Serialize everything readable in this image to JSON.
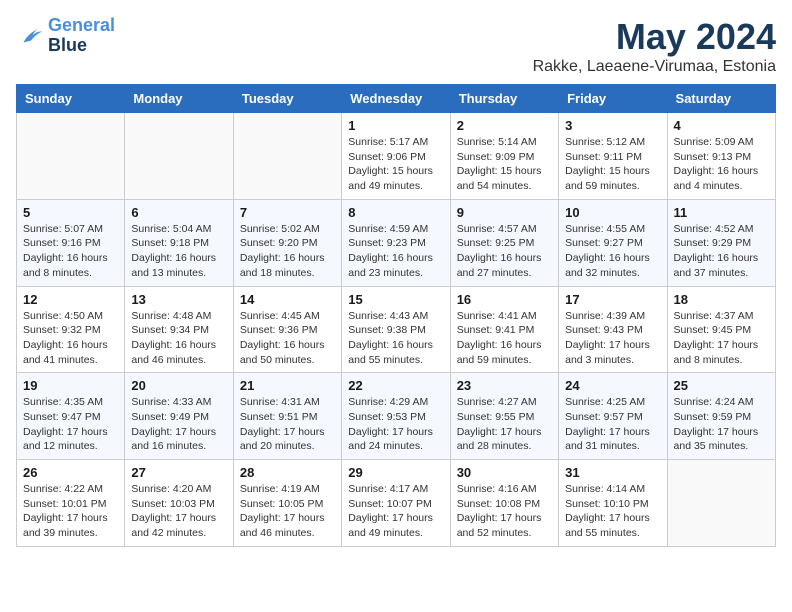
{
  "logo": {
    "line1": "General",
    "line2": "Blue"
  },
  "title": "May 2024",
  "subtitle": "Rakke, Laeaene-Virumaa, Estonia",
  "weekdays": [
    "Sunday",
    "Monday",
    "Tuesday",
    "Wednesday",
    "Thursday",
    "Friday",
    "Saturday"
  ],
  "rows": [
    [
      {
        "day": "",
        "info": ""
      },
      {
        "day": "",
        "info": ""
      },
      {
        "day": "",
        "info": ""
      },
      {
        "day": "1",
        "info": "Sunrise: 5:17 AM\nSunset: 9:06 PM\nDaylight: 15 hours and 49 minutes."
      },
      {
        "day": "2",
        "info": "Sunrise: 5:14 AM\nSunset: 9:09 PM\nDaylight: 15 hours and 54 minutes."
      },
      {
        "day": "3",
        "info": "Sunrise: 5:12 AM\nSunset: 9:11 PM\nDaylight: 15 hours and 59 minutes."
      },
      {
        "day": "4",
        "info": "Sunrise: 5:09 AM\nSunset: 9:13 PM\nDaylight: 16 hours and 4 minutes."
      }
    ],
    [
      {
        "day": "5",
        "info": "Sunrise: 5:07 AM\nSunset: 9:16 PM\nDaylight: 16 hours and 8 minutes."
      },
      {
        "day": "6",
        "info": "Sunrise: 5:04 AM\nSunset: 9:18 PM\nDaylight: 16 hours and 13 minutes."
      },
      {
        "day": "7",
        "info": "Sunrise: 5:02 AM\nSunset: 9:20 PM\nDaylight: 16 hours and 18 minutes."
      },
      {
        "day": "8",
        "info": "Sunrise: 4:59 AM\nSunset: 9:23 PM\nDaylight: 16 hours and 23 minutes."
      },
      {
        "day": "9",
        "info": "Sunrise: 4:57 AM\nSunset: 9:25 PM\nDaylight: 16 hours and 27 minutes."
      },
      {
        "day": "10",
        "info": "Sunrise: 4:55 AM\nSunset: 9:27 PM\nDaylight: 16 hours and 32 minutes."
      },
      {
        "day": "11",
        "info": "Sunrise: 4:52 AM\nSunset: 9:29 PM\nDaylight: 16 hours and 37 minutes."
      }
    ],
    [
      {
        "day": "12",
        "info": "Sunrise: 4:50 AM\nSunset: 9:32 PM\nDaylight: 16 hours and 41 minutes."
      },
      {
        "day": "13",
        "info": "Sunrise: 4:48 AM\nSunset: 9:34 PM\nDaylight: 16 hours and 46 minutes."
      },
      {
        "day": "14",
        "info": "Sunrise: 4:45 AM\nSunset: 9:36 PM\nDaylight: 16 hours and 50 minutes."
      },
      {
        "day": "15",
        "info": "Sunrise: 4:43 AM\nSunset: 9:38 PM\nDaylight: 16 hours and 55 minutes."
      },
      {
        "day": "16",
        "info": "Sunrise: 4:41 AM\nSunset: 9:41 PM\nDaylight: 16 hours and 59 minutes."
      },
      {
        "day": "17",
        "info": "Sunrise: 4:39 AM\nSunset: 9:43 PM\nDaylight: 17 hours and 3 minutes."
      },
      {
        "day": "18",
        "info": "Sunrise: 4:37 AM\nSunset: 9:45 PM\nDaylight: 17 hours and 8 minutes."
      }
    ],
    [
      {
        "day": "19",
        "info": "Sunrise: 4:35 AM\nSunset: 9:47 PM\nDaylight: 17 hours and 12 minutes."
      },
      {
        "day": "20",
        "info": "Sunrise: 4:33 AM\nSunset: 9:49 PM\nDaylight: 17 hours and 16 minutes."
      },
      {
        "day": "21",
        "info": "Sunrise: 4:31 AM\nSunset: 9:51 PM\nDaylight: 17 hours and 20 minutes."
      },
      {
        "day": "22",
        "info": "Sunrise: 4:29 AM\nSunset: 9:53 PM\nDaylight: 17 hours and 24 minutes."
      },
      {
        "day": "23",
        "info": "Sunrise: 4:27 AM\nSunset: 9:55 PM\nDaylight: 17 hours and 28 minutes."
      },
      {
        "day": "24",
        "info": "Sunrise: 4:25 AM\nSunset: 9:57 PM\nDaylight: 17 hours and 31 minutes."
      },
      {
        "day": "25",
        "info": "Sunrise: 4:24 AM\nSunset: 9:59 PM\nDaylight: 17 hours and 35 minutes."
      }
    ],
    [
      {
        "day": "26",
        "info": "Sunrise: 4:22 AM\nSunset: 10:01 PM\nDaylight: 17 hours and 39 minutes."
      },
      {
        "day": "27",
        "info": "Sunrise: 4:20 AM\nSunset: 10:03 PM\nDaylight: 17 hours and 42 minutes."
      },
      {
        "day": "28",
        "info": "Sunrise: 4:19 AM\nSunset: 10:05 PM\nDaylight: 17 hours and 46 minutes."
      },
      {
        "day": "29",
        "info": "Sunrise: 4:17 AM\nSunset: 10:07 PM\nDaylight: 17 hours and 49 minutes."
      },
      {
        "day": "30",
        "info": "Sunrise: 4:16 AM\nSunset: 10:08 PM\nDaylight: 17 hours and 52 minutes."
      },
      {
        "day": "31",
        "info": "Sunrise: 4:14 AM\nSunset: 10:10 PM\nDaylight: 17 hours and 55 minutes."
      },
      {
        "day": "",
        "info": ""
      }
    ]
  ]
}
